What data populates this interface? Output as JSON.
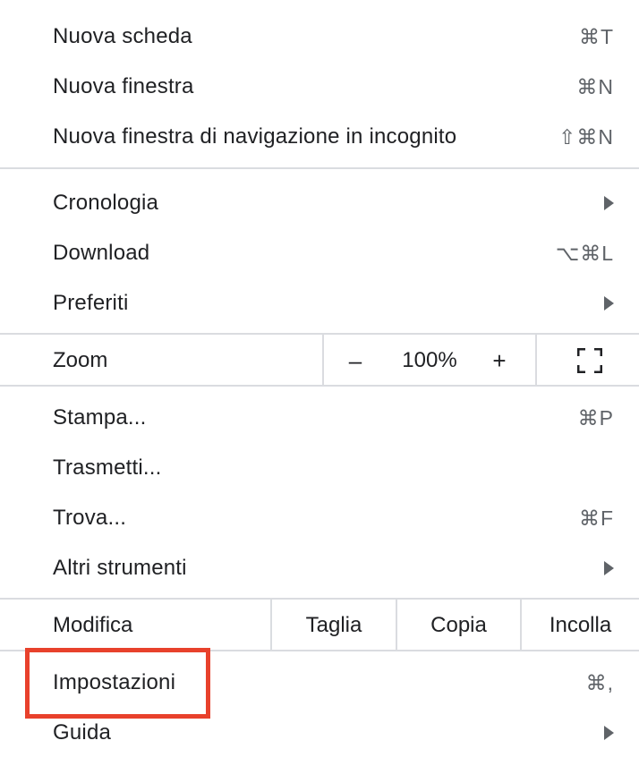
{
  "menu": {
    "new_tab": {
      "label": "Nuova scheda",
      "shortcut": "⌘T"
    },
    "new_window": {
      "label": "Nuova finestra",
      "shortcut": "⌘N"
    },
    "incognito": {
      "label": "Nuova finestra di navigazione in incognito",
      "shortcut": "⇧⌘N"
    },
    "history": {
      "label": "Cronologia"
    },
    "downloads": {
      "label": "Download",
      "shortcut": "⌥⌘L"
    },
    "bookmarks": {
      "label": "Preferiti"
    },
    "zoom": {
      "label": "Zoom",
      "minus": "–",
      "value": "100%",
      "plus": "+"
    },
    "print": {
      "label": "Stampa...",
      "shortcut": "⌘P"
    },
    "cast": {
      "label": "Trasmetti..."
    },
    "find": {
      "label": "Trova...",
      "shortcut": "⌘F"
    },
    "more_tools": {
      "label": "Altri strumenti"
    },
    "edit": {
      "label": "Modifica",
      "cut": "Taglia",
      "copy": "Copia",
      "paste": "Incolla"
    },
    "settings": {
      "label": "Impostazioni",
      "shortcut": "⌘,"
    },
    "help": {
      "label": "Guida"
    }
  },
  "icons": {
    "submenu": "chevron-right-triangle",
    "fullscreen": "fullscreen-corners-icon"
  },
  "colors": {
    "text": "#202124",
    "shortcut": "#5f6368",
    "separator": "#dadce0",
    "highlight": "#e8412c"
  }
}
